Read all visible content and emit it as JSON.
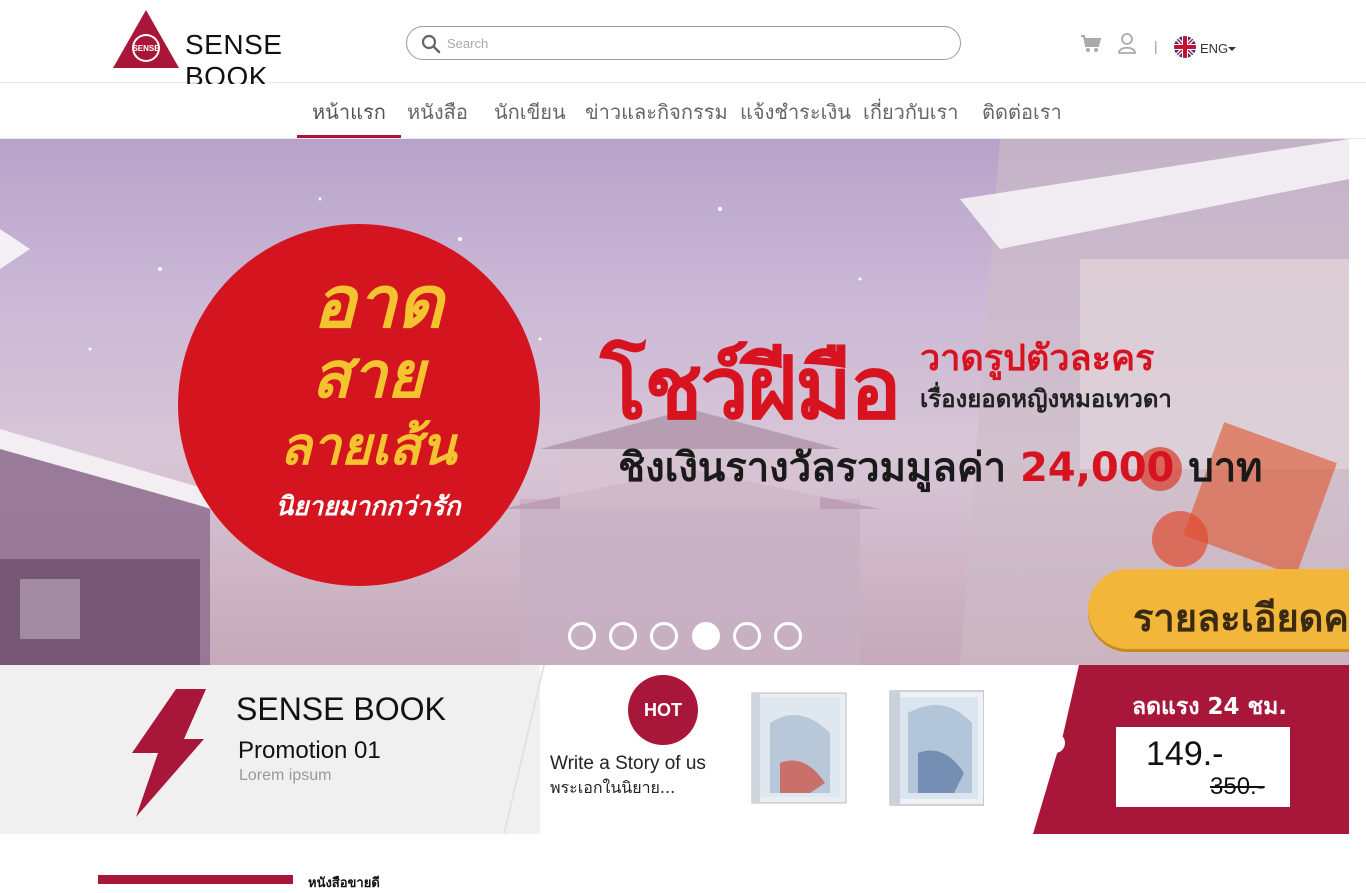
{
  "brand": {
    "name": "SENSE BOOK",
    "badge_text": "SENSE",
    "logo_color": "#a8173a"
  },
  "search": {
    "placeholder": "Search",
    "value": ""
  },
  "header": {
    "separator": "|",
    "language": "ENG",
    "icons": [
      "search-icon",
      "cart-icon",
      "user-icon",
      "uk-flag-icon",
      "chevron-down-icon"
    ]
  },
  "nav": {
    "items": [
      {
        "label": "หน้าแรก",
        "active": true
      },
      {
        "label": "หนังสือ",
        "active": false
      },
      {
        "label": "นักเขียน",
        "active": false
      },
      {
        "label": "ข่าวและกิจกรรม",
        "active": false
      },
      {
        "label": "แจ้งชำระเงิน",
        "active": false
      },
      {
        "label": "เกี่ยวกับเรา",
        "active": false
      },
      {
        "label": "ติดต่อเรา",
        "active": false
      }
    ],
    "active_color": "#a8173a"
  },
  "hero": {
    "logo_lines": [
      "อาด",
      "สาย",
      "ลายเส้น",
      "นิยายมากกว่ารัก"
    ],
    "heading": "โชว์ฝีมือ",
    "sub1": "วาดรูปตัวละคร",
    "sub2": "เรื่องยอดหญิงหมอเทวดา",
    "prize_prefix": "ชิงเงินรางวัลรวมมูลค่า",
    "prize_amount": "24,000",
    "prize_unit": "บาท",
    "cta": "รายละเอียดค",
    "slides_total": 6,
    "slide_active_index": 3
  },
  "promo": {
    "brand": "SENSE BOOK",
    "title": "Promotion 01",
    "subtitle": "Lorem ipsum",
    "hot_label": "HOT",
    "book_title": "Write a Story of us",
    "book_subtitle": "พระเอกในนิยาย...",
    "deal_label": "ลดแรง 24 ชม.",
    "price_now": "149.-",
    "price_old": "350.-",
    "accent": "#a8173a"
  },
  "section": {
    "label": "หนังสือขายดี"
  }
}
